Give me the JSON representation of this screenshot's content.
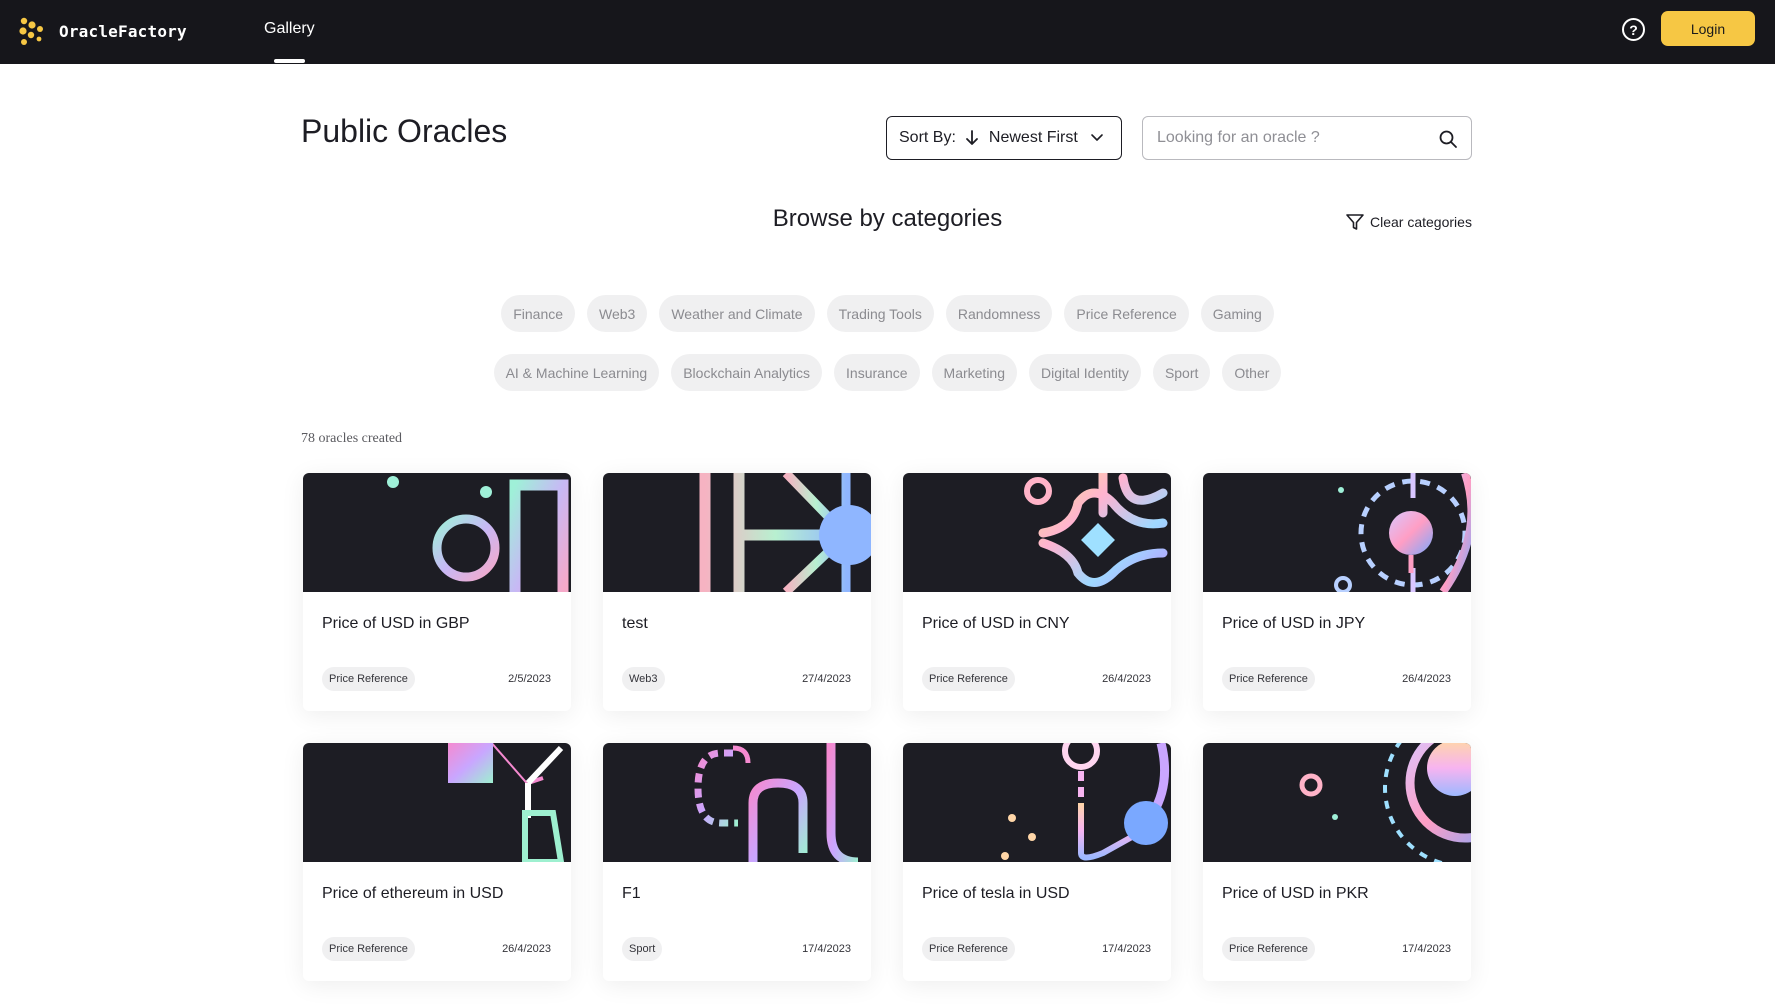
{
  "nav": {
    "brand": "OracleFactory",
    "gallery": "Gallery",
    "help_symbol": "?",
    "login": "Login"
  },
  "header": {
    "title": "Public Oracles",
    "sort_label": "Sort By:",
    "sort_value": "Newest First",
    "search_placeholder": "Looking for an oracle ?"
  },
  "categories": {
    "title": "Browse by categories",
    "clear": "Clear categories",
    "row1": [
      "Finance",
      "Web3",
      "Weather and Climate",
      "Trading Tools",
      "Randomness",
      "Price Reference",
      "Gaming"
    ],
    "row2": [
      "AI & Machine Learning",
      "Blockchain Analytics",
      "Insurance",
      "Marketing",
      "Digital Identity",
      "Sport",
      "Other"
    ]
  },
  "count_text": "78 oracles created",
  "cards": [
    {
      "title": "Price of USD in GBP",
      "tag": "Price Reference",
      "date": "2/5/2023"
    },
    {
      "title": "test",
      "tag": "Web3",
      "date": "27/4/2023"
    },
    {
      "title": "Price of USD in CNY",
      "tag": "Price Reference",
      "date": "26/4/2023"
    },
    {
      "title": "Price of USD in JPY",
      "tag": "Price Reference",
      "date": "26/4/2023"
    },
    {
      "title": "Price of ethereum in USD",
      "tag": "Price Reference",
      "date": "26/4/2023"
    },
    {
      "title": "F1",
      "tag": "Sport",
      "date": "17/4/2023"
    },
    {
      "title": "Price of tesla in USD",
      "tag": "Price Reference",
      "date": "17/4/2023"
    },
    {
      "title": "Price of USD in PKR",
      "tag": "Price Reference",
      "date": "17/4/2023"
    }
  ],
  "colors": {
    "nav_bg": "#16161b",
    "accent": "#f6c744",
    "card_art_bg": "#1d1d24",
    "chip_bg": "#f0f0f1"
  }
}
